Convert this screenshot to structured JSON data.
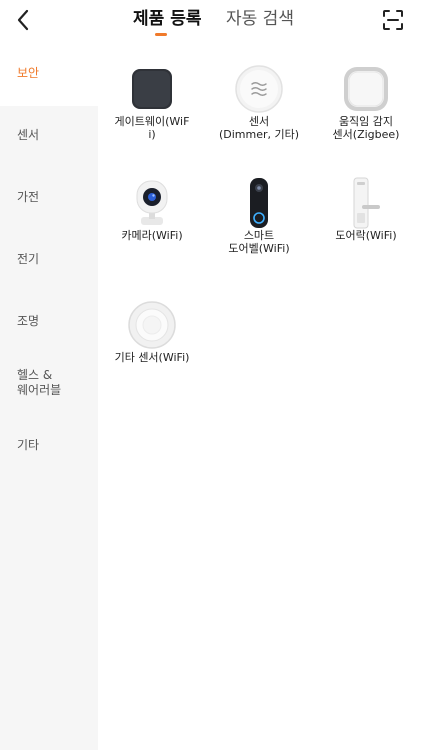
{
  "header": {
    "tabs": [
      {
        "label": "제품 등록"
      },
      {
        "label": "자동 검색"
      }
    ]
  },
  "sidebar": {
    "items": [
      {
        "label": "보안"
      },
      {
        "label": "센서"
      },
      {
        "label": "가전"
      },
      {
        "label": "전기"
      },
      {
        "label": "조명"
      },
      {
        "label": "헬스 &\n웨어러블"
      },
      {
        "label": "기타"
      }
    ]
  },
  "devices": [
    {
      "label": "게이트웨이(WiF\ni)"
    },
    {
      "label": "센서\n(Dimmer, 기타)"
    },
    {
      "label": "움직임 감지\n센서(Zigbee)"
    },
    {
      "label": "카메라(WiFi)"
    },
    {
      "label": "스마트\n도어벨(WiFi)"
    },
    {
      "label": "도어락(WiFi)"
    },
    {
      "label": "기타 센서(WiFi)"
    }
  ],
  "colors": {
    "accent": "#f07a2b",
    "sidebar_bg": "#f6f6f6"
  }
}
